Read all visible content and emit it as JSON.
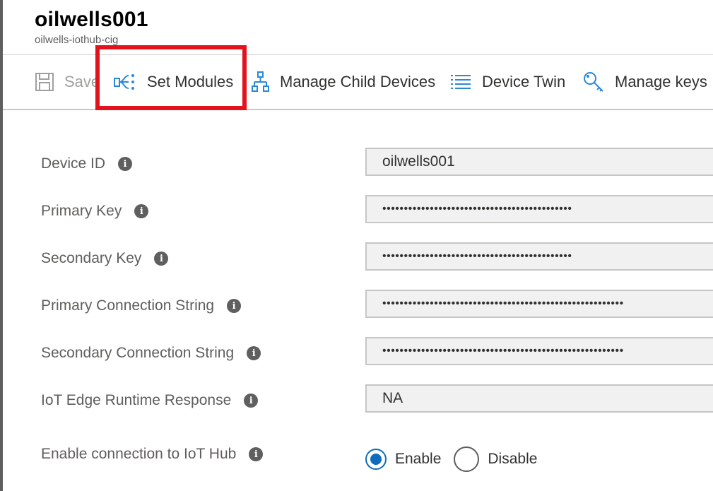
{
  "header": {
    "title": "oilwells001",
    "subtitle": "oilwells-iothub-cig"
  },
  "toolbar": {
    "save_label": "Save",
    "set_modules_label": "Set Modules",
    "manage_child_devices_label": "Manage Child Devices",
    "device_twin_label": "Device Twin",
    "manage_keys_label": "Manage keys"
  },
  "fields": {
    "device_id": {
      "label": "Device ID",
      "value": "oilwells001"
    },
    "primary_key": {
      "label": "Primary Key",
      "value": "••••••••••••••••••••••••••••••••••••••••••••"
    },
    "secondary_key": {
      "label": "Secondary Key",
      "value": "••••••••••••••••••••••••••••••••••••••••••••"
    },
    "primary_connection_string": {
      "label": "Primary Connection String",
      "value": "••••••••••••••••••••••••••••••••••••••••••••••••••••••••"
    },
    "secondary_connection_string": {
      "label": "Secondary Connection String",
      "value": "••••••••••••••••••••••••••••••••••••••••••••••••••••••••"
    },
    "iot_edge_runtime_response": {
      "label": "IoT Edge Runtime Response",
      "value": "NA"
    }
  },
  "connection": {
    "label": "Enable connection to IoT Hub",
    "enable_label": "Enable",
    "disable_label": "Disable",
    "selected": "Enable"
  },
  "info_glyph": "i",
  "colors": {
    "accent": "#0f6cbd",
    "highlight": "#e3131e",
    "icon_blue": "#2b88d8"
  },
  "icons": {
    "save": "save-icon",
    "set_modules": "set-modules-icon",
    "manage_child_devices": "hierarchy-icon",
    "device_twin": "list-icon",
    "manage_keys": "key-icon",
    "info": "info-icon"
  }
}
